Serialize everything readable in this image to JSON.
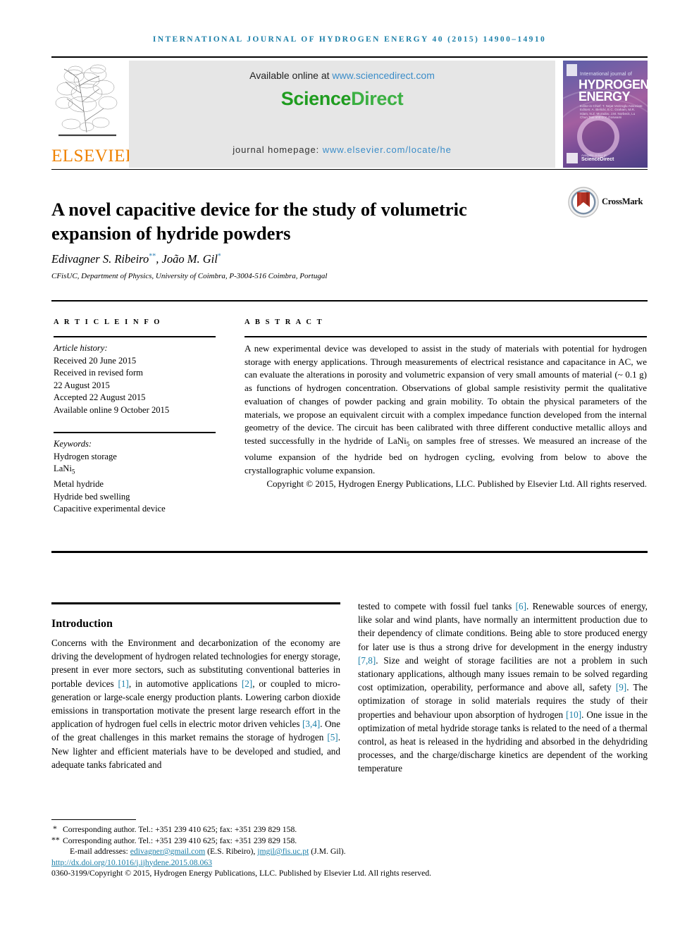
{
  "running_head": "International Journal of Hydrogen Energy 40 (2015) 14900–14910",
  "masthead": {
    "publisher_name": "ELSEVIER",
    "available_prefix": "Available online at ",
    "available_url": "www.sciencedirect.com",
    "wordmark_science": "Science",
    "wordmark_direct": "Direct",
    "homepage_prefix": "journal homepage: ",
    "homepage_url": "www.elsevier.com/locate/he",
    "cover": {
      "line_small": "International journal of",
      "line1": "HYDROGEN",
      "line2": "ENERGY",
      "editors": "Editor-in-Chief: T. Nejat Veziroglu    Associate Editors: A. Bielicki, E.C. Graham, M.R. Islam, N.Z. Muradov, J.M. Norbeck, Lu Chun Tsai and D.Y. Goswami",
      "brand": "ScienceDirect",
      "brand_small": "Available online at"
    }
  },
  "article": {
    "title": "A novel capacitive device for the study of volumetric expansion of hydride powders",
    "crossmark_label": "CrossMark",
    "authors": "Edivagner S. Ribeiro",
    "author_mark_1": "**",
    "authors_2": ", João M. Gil",
    "author_mark_2": "*",
    "affiliation": "CFisUC, Department of Physics, University of Coimbra, P-3004-516 Coimbra, Portugal"
  },
  "sections": {
    "article_info_label": "A R T I C L E   I N F O",
    "abstract_label": "A B S T R A C T",
    "introduction_heading": "Introduction"
  },
  "article_history": {
    "heading": "Article history:",
    "lines": [
      "Received 20 June 2015",
      "Received in revised form",
      "22 August 2015",
      "Accepted 22 August 2015",
      "Available online 9 October 2015"
    ]
  },
  "keywords": {
    "heading": "Keywords:",
    "items": [
      "Hydrogen storage",
      "LaNi5",
      "Metal hydride",
      "Hydride bed swelling",
      "Capacitive experimental device"
    ]
  },
  "abstract": {
    "text": "A new experimental device was developed to assist in the study of materials with potential for hydrogen storage with energy applications. Through measurements of electrical resistance and capacitance in AC, we can evaluate the alterations in porosity and volumetric expansion of very small amounts of material (~ 0.1 g) as functions of hydrogen concentration. Observations of global sample resistivity permit the qualitative evaluation of changes of powder packing and grain mobility. To obtain the physical parameters of the materials, we propose an equivalent circuit with a complex impedance function developed from the internal geometry of the device. The circuit has been calibrated with three different conductive metallic alloys and tested successfully in the hydride of LaNi5 on samples free of stresses. We measured an increase of the volume expansion of the hydride bed on hydrogen cycling, evolving from below to above the crystallographic volume expansion.",
    "copyright": "Copyright © 2015, Hydrogen Energy Publications, LLC. Published by Elsevier Ltd. All rights reserved."
  },
  "body": {
    "left_column": "Concerns with the Environment and decarbonization of the economy are driving the development of hydrogen related technologies for energy storage, present in ever more sectors, such as substituting conventional batteries in portable devices [1], in automotive applications [2], or coupled to micro-generation or large-scale energy production plants. Lowering carbon dioxide emissions in transportation motivate the present large research effort in the application of hydrogen fuel cells in electric motor driven vehicles [3,4]. One of the great challenges in this market remains the storage of hydrogen [5]. New lighter and efficient materials have to be developed and studied, and adequate tanks fabricated and",
    "right_column": "tested to compete with fossil fuel tanks [6]. Renewable sources of energy, like solar and wind plants, have normally an intermittent production due to their dependency of climate conditions. Being able to store produced energy for later use is thus a strong drive for development in the energy industry [7,8]. Size and weight of storage facilities are not a problem in such stationary applications, although many issues remain to be solved regarding cost optimization, operability, performance and above all, safety [9]. The optimization of storage in solid materials requires the study of their properties and behaviour upon absorption of hydrogen [10]. One issue in the optimization of metal hydride storage tanks is related to the need of a thermal control, as heat is released in the hydriding and absorbed in the dehydriding processes, and the charge/discharge kinetics are dependent of the working temperature"
  },
  "footnotes": {
    "corresponding_1_mark": "*",
    "corresponding_1": "Corresponding author. Tel.: +351 239 410 625; fax: +351 239 829 158.",
    "corresponding_2_mark": "**",
    "corresponding_2": "Corresponding author. Tel.: +351 239 410 625; fax: +351 239 829 158.",
    "email_label": "E-mail addresses:",
    "email_1": "edivagner@gmail.com",
    "email_1_who": "(E.S. Ribeiro),",
    "email_2": "jmgil@fis.uc.pt",
    "email_2_who": "(J.M. Gil).",
    "doi": "http://dx.doi.org/10.1016/j.ijhydene.2015.08.063",
    "issn_line": "0360-3199/Copyright © 2015, Hydrogen Energy Publications, LLC. Published by Elsevier Ltd. All rights reserved."
  },
  "colors": {
    "accent_blue": "#1b7fa8",
    "link_blue": "#3a8cc8",
    "elsevier_orange": "#ef8200",
    "sciencedirect_green": "#2aa52a"
  }
}
